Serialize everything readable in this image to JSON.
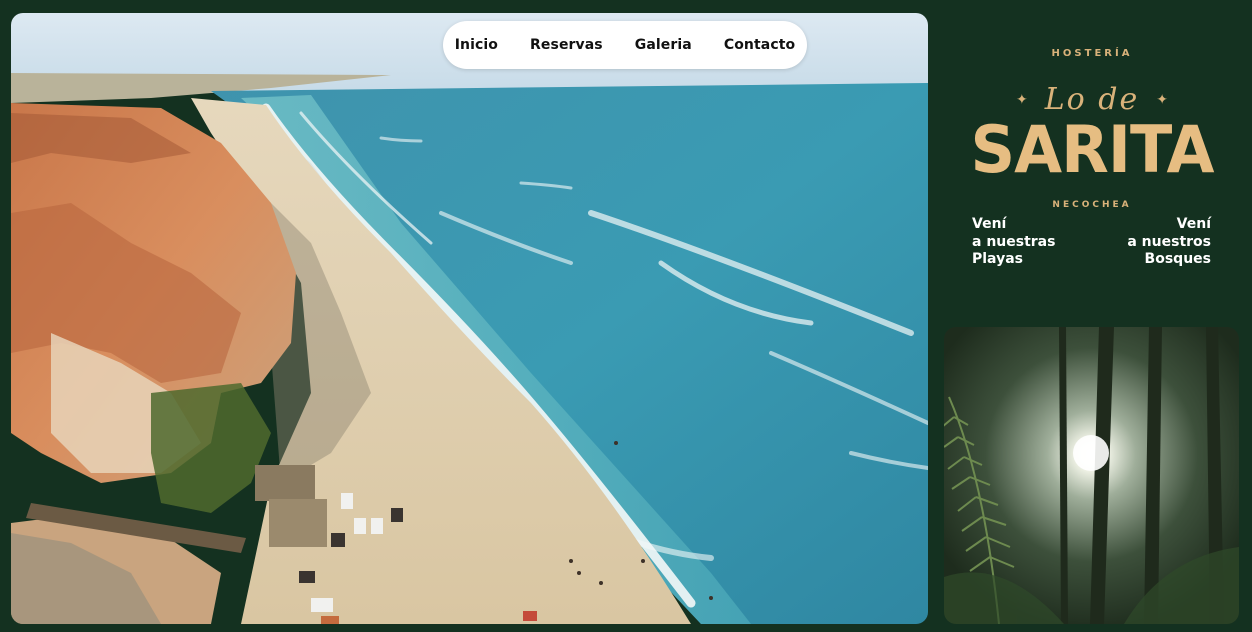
{
  "nav": {
    "items": [
      {
        "label": "Inicio"
      },
      {
        "label": "Reservas"
      },
      {
        "label": "Galeria"
      },
      {
        "label": "Contacto"
      }
    ]
  },
  "brand": {
    "top_label": "HOSTERÍA",
    "script": "Lo de",
    "name": "SARITA",
    "location": "NECOCHEA",
    "colors": {
      "gold": "#d9b27a",
      "background": "#143120"
    }
  },
  "taglines": {
    "left": [
      "Vení",
      "a nuestras",
      "Playas"
    ],
    "right": [
      "Vení",
      "a nuestros",
      "Bosques"
    ]
  },
  "images": {
    "hero": "aerial-beach-cliffs",
    "card": "forest-sunlight"
  }
}
